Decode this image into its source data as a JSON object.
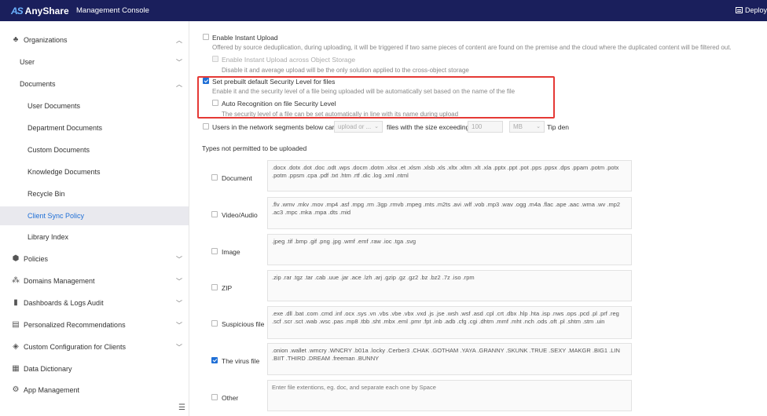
{
  "header": {
    "logo_mark": "AS",
    "brand": "AnyShare",
    "title": "Management Console",
    "deploy_label": "Deploy"
  },
  "sidebar": {
    "items": [
      {
        "label": "Organizations",
        "level": 0,
        "icon": "org-icon",
        "chevron": "up"
      },
      {
        "label": "User",
        "level": 1,
        "chevron": "down"
      },
      {
        "label": "Documents",
        "level": 1,
        "chevron": "up"
      },
      {
        "label": "User Documents",
        "level": 2
      },
      {
        "label": "Department Documents",
        "level": 2
      },
      {
        "label": "Custom Documents",
        "level": 2
      },
      {
        "label": "Knowledge Documents",
        "level": 2
      },
      {
        "label": "Recycle Bin",
        "level": 2
      },
      {
        "label": "Client Sync Policy",
        "level": 2,
        "active": true
      },
      {
        "label": "Library Index",
        "level": 2
      },
      {
        "label": "Policies",
        "level": 0,
        "icon": "shield-icon",
        "chevron": "down"
      },
      {
        "label": "Domains Management",
        "level": 0,
        "icon": "domain-icon",
        "chevron": "down"
      },
      {
        "label": "Dashboards & Logs Audit",
        "level": 0,
        "icon": "chart-icon",
        "chevron": "down"
      },
      {
        "label": "Personalized Recommendations",
        "level": 0,
        "icon": "recommend-icon",
        "chevron": "down"
      },
      {
        "label": "Custom Configuration for Clients",
        "level": 0,
        "icon": "config-icon",
        "chevron": "down"
      },
      {
        "label": "Data Dictionary",
        "level": 0,
        "icon": "dictionary-icon"
      },
      {
        "label": "App Management",
        "level": 0,
        "icon": "app-icon"
      }
    ]
  },
  "settings": {
    "instant_upload_label": "Enable Instant Upload",
    "instant_upload_desc": "Offered by source deduplication, during uploading, it will be triggered if two same pieces of content are found on the premise and the cloud where the duplicated content will be filtered out.",
    "instant_upload_os_label": "Enable Instant Upload across Object Storage",
    "instant_upload_os_desc": "Disable it and average upload will be the only solution applied to the cross-object storage",
    "security_level_label": "Set prebuilt default Security Level for files",
    "security_level_desc": "Enable it and the security level of a file being uploaded will be automatically set based on the name of the file",
    "auto_recognition_label": "Auto Recognition on file Security Level",
    "auto_recognition_desc": "The security level of a file can be set automatically in line with its name during upload",
    "network_segment_label": "Users in the network segments below can",
    "network_action_placeholder": "upload or ...",
    "size_exceeding_label": "files with the size exceeding",
    "size_value": "100",
    "size_unit": "MB",
    "tip_label": "Tip den",
    "types_heading": "Types not permitted to be uploaded"
  },
  "file_types": [
    {
      "label": "Document",
      "checked": false,
      "extensions": ".docx .dotx .dot .doc .odt .wps .docm .dotm .xlsx .et .xlsm .xlsb .xls .xltx .xltm .xlt .xla .pptx .ppt .pot .pps .ppsx .dps .ppam .potm .potx .potm .ppsm .cpa .pdf .txt .htm .rtf .dic .log .xml .ntml"
    },
    {
      "label": "Video/Audio",
      "checked": false,
      "extensions": ".flv .wmv .mkv .mov .mp4 .asf .mpg .rm .3gp .rmvb .mpeg .mts .m2ts .avi .wlf .vob .mp3 .wav .ogg .m4a .flac .ape .aac .wma .wv .mp2 .ac3 .mpc .mka .mpa .dts .mid"
    },
    {
      "label": "Image",
      "checked": false,
      "extensions": ".jpeg .tif .bmp .gif .png .jpg .wmf .emf .raw .ioc .tga .svg"
    },
    {
      "label": "ZIP",
      "checked": false,
      "extensions": ".zip .rar .tgz .tar .cab .uue .jar .ace .lzh .arj .gzip .gz .gz2 .bz .bz2 .7z .iso .rpm"
    },
    {
      "label": "Suspicious file",
      "checked": false,
      "extensions": ".exe .dll .bat .com .cmd .inf .ocx .sys .vn .vbs .vbe .vbx .vxd .js .jse .wsh .wsf .asd .cpl .crt .dbx .hlp .hta .isp .nws .ops .pcd .pl .prf .reg .scf .scr .sct .wab .wsc .pas .mp8 .tbb .sht .mbx .eml .pmr .fpt .inb .adb .cfg .cgi .dhtm .mmf .mht .nch .ods .oft .pl .shtm .stm .uin"
    },
    {
      "label": "The virus file",
      "checked": true,
      "extensions": ".onion .wallet .wmcry .WNCRY .b01a .locky .Cerber3 .CHAK .GOTHAM .YAYA .GRANNY .SKUNK .TRUE .SEXY .MAKGR .BIG1 .LIN .BIIT .THIRD .DREAM .freeman .BUNNY"
    },
    {
      "label": "Other",
      "checked": false,
      "extensions": "",
      "placeholder": "Enter file extentions, eg. doc, and separate each one by Space"
    }
  ],
  "colors": {
    "topbar": "#1a1f5c",
    "accent": "#1f6fd6",
    "highlight": "#e53935"
  }
}
